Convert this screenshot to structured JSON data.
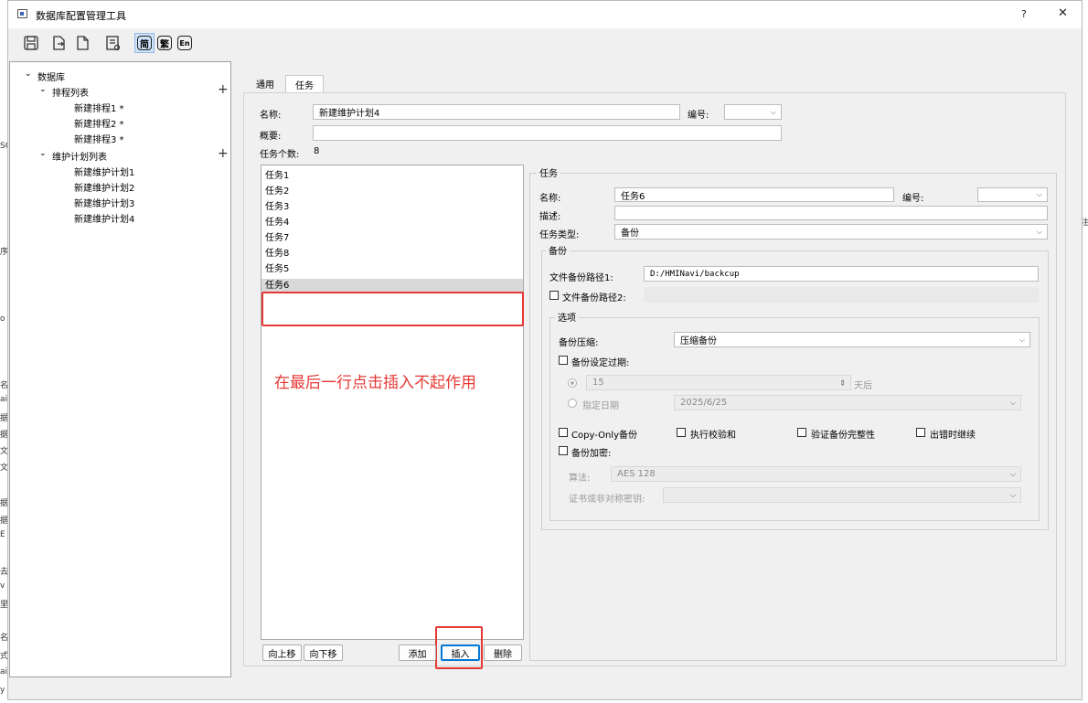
{
  "window": {
    "title": "数据库配置管理工具",
    "help_btn": "?",
    "close_btn": "✕"
  },
  "toolbar": {
    "lang_simplified": "简",
    "lang_traditional": "繁",
    "lang_english": "En"
  },
  "tree": {
    "root": "数据库",
    "schedule_list": "排程列表",
    "schedules": [
      "新建排程1 *",
      "新建排程2 *",
      "新建排程3 *"
    ],
    "maintenance_list": "维护计划列表",
    "plans": [
      "新建维护计划1",
      "新建维护计划2",
      "新建维护计划3",
      "新建维护计划4"
    ]
  },
  "tabs": [
    "通用",
    "任务"
  ],
  "plan_form": {
    "name_label": "名称:",
    "name_value": "新建维护计划4",
    "number_label": "编号:",
    "summary_label": "概要:",
    "task_count_label": "任务个数:",
    "task_count": "8"
  },
  "task_list": [
    "任务1",
    "任务2",
    "任务3",
    "任务4",
    "任务7",
    "任务8",
    "任务5",
    "任务6"
  ],
  "list_buttons": {
    "up": "向上移",
    "down": "向下移",
    "add": "添加",
    "insert": "插入",
    "delete": "删除"
  },
  "task_group": {
    "title": "任务",
    "name_label": "名称:",
    "name_value": "任务6",
    "number_label": "编号:",
    "desc_label": "描述:",
    "type_label": "任务类型:",
    "type_value": "备份"
  },
  "backup_group": {
    "title": "备份",
    "path1_label": "文件备份路径1:",
    "path1_value": "D:/HMINavi/backcup",
    "path2_label": "文件备份路径2:"
  },
  "options_group": {
    "title": "选项",
    "compress_label": "备份压缩:",
    "compress_value": "压缩备份",
    "expire_label": "备份设定过期:",
    "days_value": "15",
    "days_suffix": "天后",
    "date_label": "指定日期",
    "date_value": "2025/6/25",
    "copy_only": "Copy-Only备份",
    "checksum": "执行校验和",
    "verify": "验证备份完整性",
    "continue_on_error": "出错时继续",
    "encrypt_label": "备份加密:",
    "algorithm_label": "算法:",
    "algorithm_value": "AES 128",
    "cert_label": "证书或非对称密钥:"
  },
  "annotation": "在最后一行点击插入不起作用",
  "left_edge_fragments": [
    "SC",
    "序",
    "o",
    "名",
    "ai",
    "据",
    "据",
    "文",
    "文",
    "据",
    "据",
    "E",
    "去",
    "v",
    "里",
    "名",
    "式",
    "ai",
    "y"
  ],
  "right_edge_fragments": [
    "注"
  ]
}
